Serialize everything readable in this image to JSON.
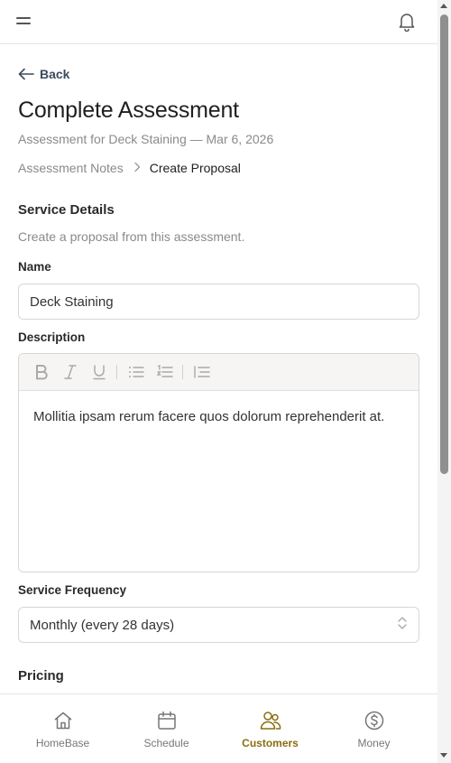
{
  "topbar": {
    "menu_icon": "hamburger-icon",
    "notification_icon": "bell-icon"
  },
  "back_label": "Back",
  "page": {
    "title": "Complete Assessment",
    "subtitle": "Assessment for Deck Staining — Mar 6, 2026"
  },
  "breadcrumb": {
    "previous": "Assessment Notes",
    "current": "Create Proposal"
  },
  "service_details": {
    "title": "Service Details",
    "description": "Create a proposal from this assessment.",
    "name_label": "Name",
    "name_value": "Deck Staining",
    "description_label": "Description",
    "description_value": "Mollitia ipsam rerum facere quos dolorum reprehenderit at.",
    "toolbar": [
      "bold-icon",
      "italic-icon",
      "underline-icon",
      "bullet-list-icon",
      "numbered-list-icon",
      "indent-icon"
    ],
    "frequency_label": "Service Frequency",
    "frequency_value": "Monthly (every 28 days)"
  },
  "pricing": {
    "title": "Pricing"
  },
  "nav": {
    "items": [
      {
        "label": "HomeBase",
        "icon": "home-icon"
      },
      {
        "label": "Schedule",
        "icon": "calendar-icon"
      },
      {
        "label": "Customers",
        "icon": "users-icon",
        "active": true
      },
      {
        "label": "Money",
        "icon": "dollar-icon"
      }
    ]
  },
  "colors": {
    "accent": "#8a6d10",
    "muted_text": "#8a8a8a",
    "border": "#d7d7d7"
  }
}
